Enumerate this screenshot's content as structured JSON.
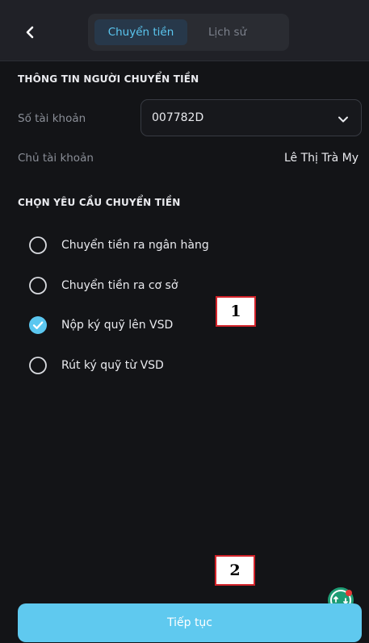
{
  "header": {
    "tabs": [
      {
        "label": "Chuyển tiền",
        "active": true
      },
      {
        "label": "Lịch sử",
        "active": false
      }
    ]
  },
  "sender_info": {
    "title": "THÔNG TIN NGƯỜI CHUYỂN TIỀN",
    "account_number_label": "Số tài khoản",
    "account_number_value": "007782D",
    "account_holder_label": "Chủ tài khoản",
    "account_holder_value": "Lê Thị Trà My"
  },
  "request": {
    "title": "CHỌN YÊU CẦU CHUYỂN TIỀN",
    "options": [
      {
        "label": "Chuyển tiền ra ngân hàng",
        "selected": false
      },
      {
        "label": "Chuyển tiền ra cơ sở",
        "selected": false
      },
      {
        "label": "Nộp ký quỹ lên VSD",
        "selected": true
      },
      {
        "label": "Rút ký quỹ từ VSD",
        "selected": false
      }
    ]
  },
  "annotations": {
    "callout_1": "1",
    "callout_2": "2"
  },
  "footer": {
    "continue_label": "Tiếp tục"
  },
  "colors": {
    "background": "#131417",
    "accent": "#5fc9ef",
    "callout_border": "#d2232a"
  }
}
